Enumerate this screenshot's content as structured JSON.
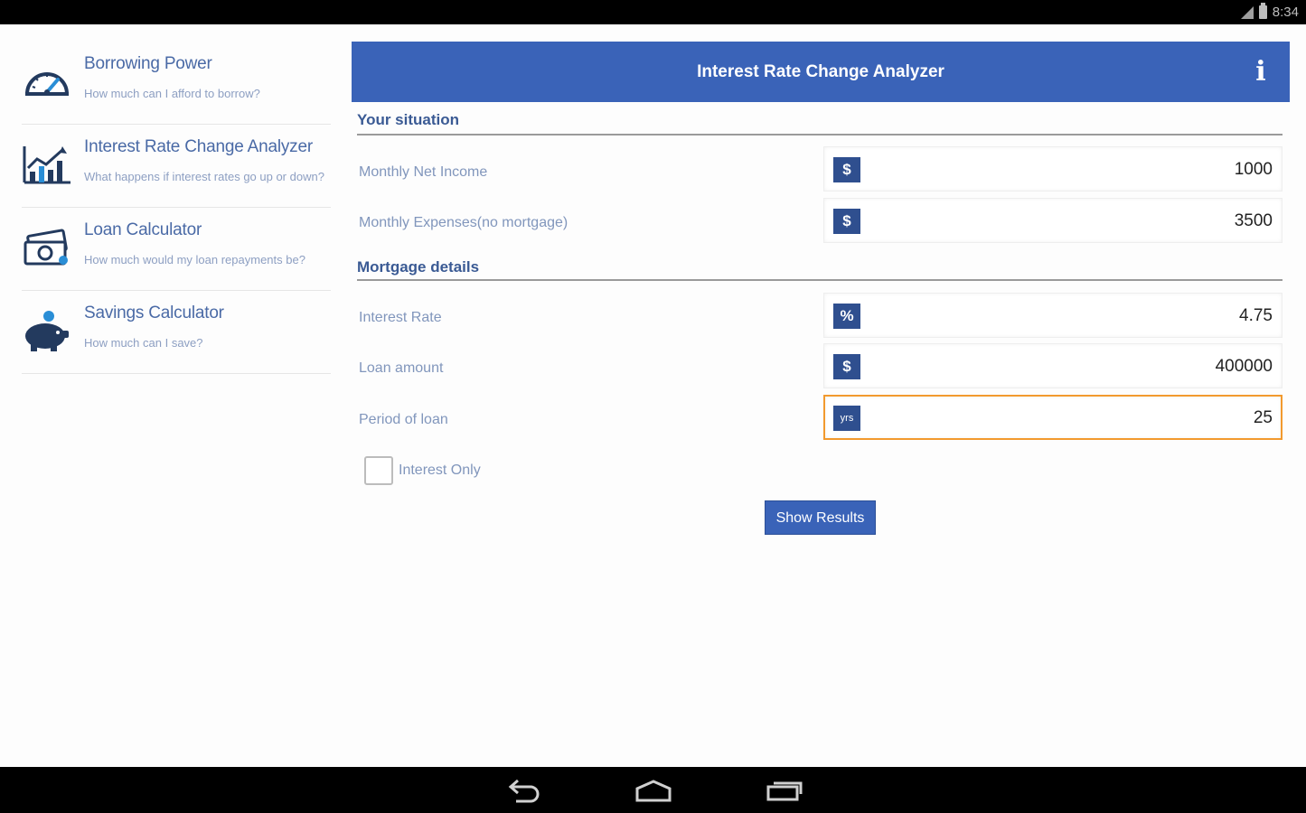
{
  "status_bar": {
    "time": "8:34",
    "icons": [
      "signal-icon",
      "battery-icon"
    ]
  },
  "sidebar": {
    "items": [
      {
        "title": "Borrowing Power",
        "subtitle": "How much can I afford to borrow?",
        "icon": "speedometer-icon"
      },
      {
        "title": "Interest Rate Change Analyzer",
        "subtitle": "What happens if interest rates go up or down?",
        "icon": "chart-icon"
      },
      {
        "title": "Loan Calculator",
        "subtitle": "How much would my loan repayments be?",
        "icon": "money-icon"
      },
      {
        "title": "Savings Calculator",
        "subtitle": "How much can I save?",
        "icon": "piggy-bank-icon"
      }
    ]
  },
  "header": {
    "title": "Interest Rate Change Analyzer",
    "info_icon": "info-icon",
    "info_glyph": "i"
  },
  "sections": {
    "situation": {
      "title": "Your situation",
      "fields": [
        {
          "label": "Monthly Net Income",
          "badge": "$",
          "value": "1000"
        },
        {
          "label": "Monthly Expenses(no mortgage)",
          "badge": "$",
          "value": "3500"
        }
      ]
    },
    "mortgage": {
      "title": "Mortgage details",
      "fields": [
        {
          "label": "Interest Rate",
          "badge": "%",
          "value": "4.75"
        },
        {
          "label": "Loan amount",
          "badge": "$",
          "value": "400000"
        },
        {
          "label": "Period of loan",
          "badge": "yrs",
          "value": "25",
          "focused": true
        }
      ]
    }
  },
  "interest_only": {
    "label": "Interest Only",
    "checked": false
  },
  "show_results": {
    "label": "Show Results"
  },
  "nav_bar": {
    "buttons": [
      "back-icon",
      "home-icon",
      "recents-icon"
    ]
  },
  "colors": {
    "accent": "#3a63b8",
    "badge": "#2f4f8f",
    "focus": "#f29a2e",
    "label": "#8196bc",
    "sidebar_title": "#4a6aa6"
  }
}
